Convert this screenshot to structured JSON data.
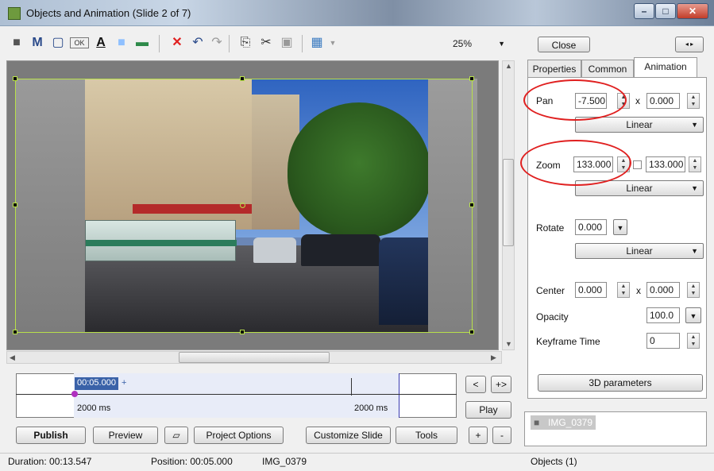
{
  "window": {
    "title": "Objects and Animation  (Slide 2 of 7)",
    "controls": [
      "minimize",
      "maximize",
      "close"
    ]
  },
  "toolbar": {
    "icons": [
      "camera-icon",
      "m-icon",
      "frame-icon",
      "ok-button-icon",
      "text-icon",
      "rectangle-icon",
      "image-icon",
      "delete-icon",
      "undo-icon",
      "redo-icon",
      "copy-icon",
      "cut-icon",
      "paste-icon",
      "grid-icon"
    ],
    "m_label": "M",
    "text_label": "A",
    "ok_label": "OK",
    "zoom": "25%"
  },
  "close_label": "Close",
  "tabs": [
    {
      "label": "Properties",
      "active": false
    },
    {
      "label": "Common",
      "active": false
    },
    {
      "label": "Animation",
      "active": true
    }
  ],
  "animation": {
    "pan_label": "Pan",
    "pan_x": "-7.500",
    "pan_y": "0.000",
    "pan_mode": "Linear",
    "x_sep": "x",
    "zoom_label": "Zoom",
    "zoom_x": "133.000",
    "zoom_y": "133.000",
    "zoom_mode": "Linear",
    "rotate_label": "Rotate",
    "rotate_value": "0.000",
    "rotate_mode": "Linear",
    "center_label": "Center",
    "center_x": "0.000",
    "center_y": "0.000",
    "opacity_label": "Opacity",
    "opacity_value": "100.0",
    "keyframe_label": "Keyframe Time",
    "keyframe_value": "0",
    "params_button": "3D parameters"
  },
  "timeline": {
    "current_time": "00:05.000",
    "plus_mark": "+",
    "left_duration": "2000 ms",
    "right_duration": "2000 ms"
  },
  "nav_buttons": {
    "prev": "<",
    "fit": "+>",
    "play": "Play",
    "add": "+",
    "remove": "-"
  },
  "bottom_buttons": {
    "publish": "Publish",
    "preview": "Preview",
    "project_options": "Project Options",
    "customize_slide": "Customize Slide",
    "tools": "Tools"
  },
  "objects": {
    "items": [
      "IMG_0379"
    ]
  },
  "status": {
    "duration": "Duration: 00:13.547",
    "position": "Position: 00:05.000",
    "object": "IMG_0379",
    "objects_count": "Objects (1)"
  },
  "colors": {
    "accent_ring": "#e02020",
    "selection_border": "#b8e04a",
    "timeline_label": "#3a62a8"
  }
}
